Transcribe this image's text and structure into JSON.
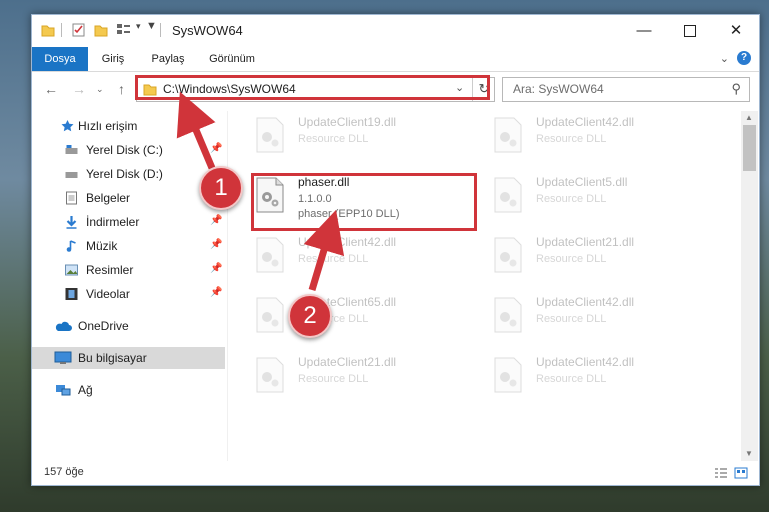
{
  "window": {
    "title": "SysWOW64"
  },
  "ribbon": {
    "tabs": [
      "Dosya",
      "Giriş",
      "Paylaş",
      "Görünüm"
    ]
  },
  "address": {
    "path": "C:\\Windows\\SysWOW64"
  },
  "search": {
    "placeholder": "Ara: SysWOW64"
  },
  "sidebar": {
    "items": [
      {
        "label": "Hızlı erişim"
      },
      {
        "label": "Yerel Disk (C:)"
      },
      {
        "label": "Yerel Disk (D:)"
      },
      {
        "label": "Belgeler"
      },
      {
        "label": "İndirmeler"
      },
      {
        "label": "Müzik"
      },
      {
        "label": "Resimler"
      },
      {
        "label": "Videolar"
      },
      {
        "label": "OneDrive"
      },
      {
        "label": "Bu bilgisayar"
      },
      {
        "label": "Ağ"
      }
    ]
  },
  "files": [
    {
      "name": "UpdateClient19.dll",
      "type": "Resource DLL"
    },
    {
      "name": "UpdateClient42.dll",
      "type": "Resource DLL"
    },
    {
      "name": "phaser.dll",
      "version": "1.1.0.0",
      "type": "phaser (EPP10 DLL)"
    },
    {
      "name": "UpdateClient5.dll",
      "type": "Resource DLL"
    },
    {
      "name": "UpdateClient42.dll",
      "type": "Resource DLL"
    },
    {
      "name": "UpdateClient21.dll",
      "type": "Resource DLL"
    },
    {
      "name": "UpdateClient65.dll",
      "type": "Resource DLL"
    },
    {
      "name": "UpdateClient42.dll",
      "type": "Resource DLL"
    },
    {
      "name": "UpdateClient21.dll",
      "type": "Resource DLL"
    },
    {
      "name": "UpdateClient42.dll",
      "type": "Resource DLL"
    }
  ],
  "status": {
    "count": "157 öğe"
  },
  "annotations": {
    "step1": "1",
    "step2": "2"
  },
  "colors": {
    "accent": "#1a74c5",
    "highlight": "#d0343a",
    "selected": "#d9d9d9"
  }
}
